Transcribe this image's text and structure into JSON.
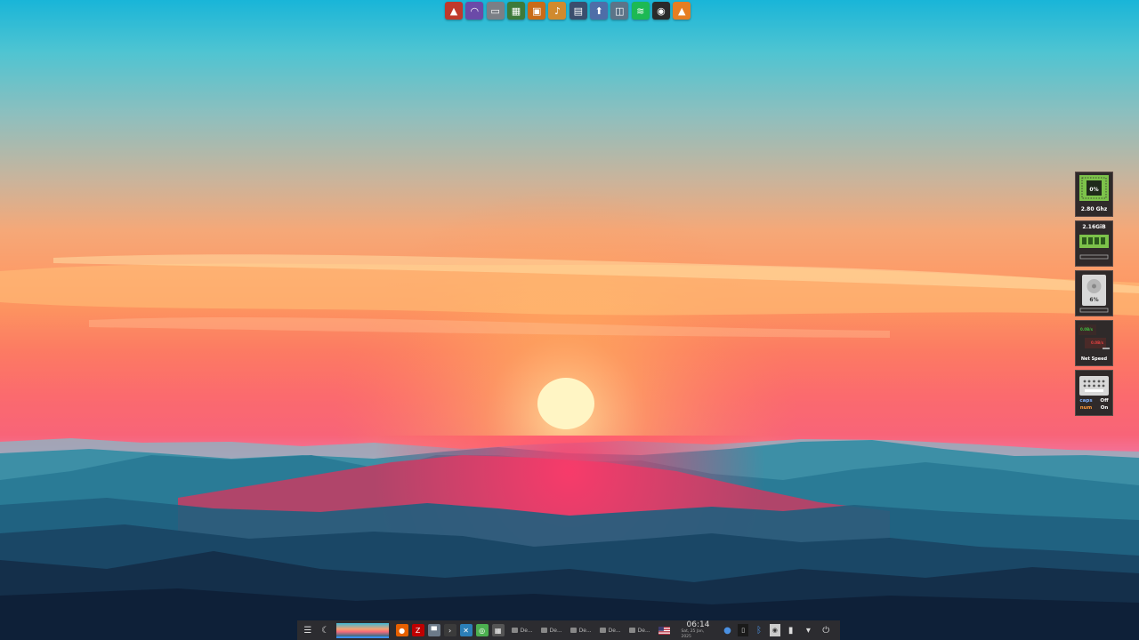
{
  "top_dock": {
    "apps": [
      {
        "icon": "app-red-triangle-icon",
        "color": "#c0392b",
        "glyph": "▲"
      },
      {
        "icon": "headphones-icon",
        "color": "#6b4aa8",
        "glyph": "◠"
      },
      {
        "icon": "network-drive-icon",
        "color": "#7b7f86",
        "glyph": "▭"
      },
      {
        "icon": "system-monitor-icon",
        "color": "#3d7a3a",
        "glyph": "▦"
      },
      {
        "icon": "package-manager-icon",
        "color": "#c96b18",
        "glyph": "▣"
      },
      {
        "icon": "audio-editor-icon",
        "color": "#d08a2e",
        "glyph": "♪"
      },
      {
        "icon": "file-manager-icon",
        "color": "#3a4e6e",
        "glyph": "▤"
      },
      {
        "icon": "upload-icon",
        "color": "#4e6ea8",
        "glyph": "⬆"
      },
      {
        "icon": "screenshot-icon",
        "color": "#5c7488",
        "glyph": "◫"
      },
      {
        "icon": "spotify-icon",
        "color": "#1db954",
        "glyph": "≋"
      },
      {
        "icon": "screen-recorder-icon",
        "color": "#2a2a2a",
        "glyph": "◉"
      },
      {
        "icon": "vlc-icon",
        "color": "#e67e22",
        "glyph": "▲"
      }
    ]
  },
  "widgets": {
    "cpu": {
      "usage": "0%",
      "frequency": "2.80 Ghz"
    },
    "ram": {
      "used": "2.16GiB"
    },
    "disk": {
      "usage": "6%"
    },
    "net": {
      "down": "0.0B/s",
      "up": "0.0B/s",
      "label": "Net Speed"
    },
    "keyboard": {
      "caps_label": "caps",
      "caps_state": "Off",
      "num_label": "num",
      "num_state": "On"
    }
  },
  "taskbar": {
    "pinned_apps": [
      {
        "icon": "firefox-icon",
        "color": "#e66000",
        "glyph": "●"
      },
      {
        "icon": "filezilla-icon",
        "color": "#bf0000",
        "glyph": "Z"
      },
      {
        "icon": "screen-cast-icon",
        "color": "#6c7a89",
        "glyph": "▀"
      },
      {
        "icon": "terminal-icon",
        "color": "#3b3b3b",
        "glyph": "›"
      },
      {
        "icon": "system-tools-icon",
        "color": "#2b7fb8",
        "glyph": "✕"
      },
      {
        "icon": "chrome-icon",
        "color": "#4caf50",
        "glyph": "◎"
      },
      {
        "icon": "grid-app-icon",
        "color": "#555",
        "glyph": "▦"
      }
    ],
    "tasks": [
      {
        "label": "De..."
      },
      {
        "label": "De..."
      },
      {
        "label": "De..."
      },
      {
        "label": "De..."
      },
      {
        "label": "De..."
      }
    ],
    "clock": {
      "time": "06:14",
      "date": "Sat, 25 Jan, 2025"
    }
  }
}
